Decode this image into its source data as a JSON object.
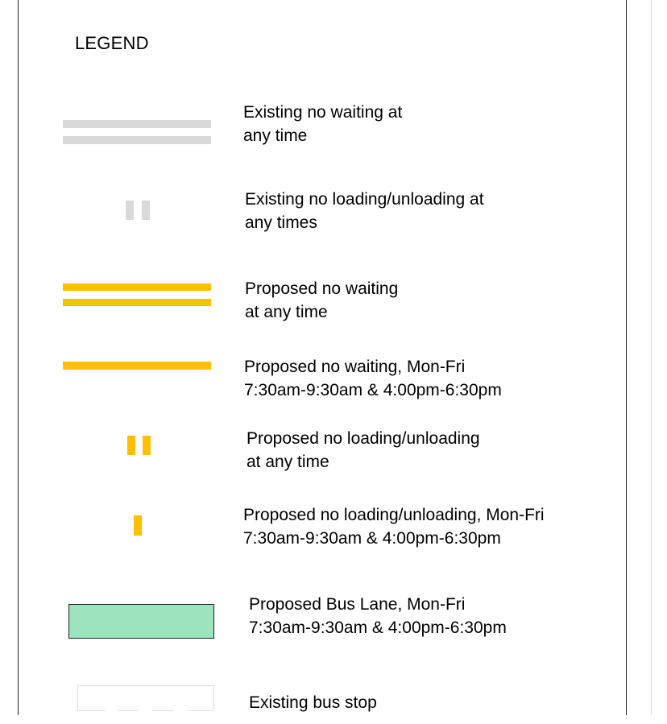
{
  "legend": {
    "title": "LEGEND",
    "colors": {
      "existing": "#d9d9d9",
      "proposed": "#ffc000",
      "bus_lane_fill": "#9de3bd",
      "bus_lane_border": "#222222",
      "bus_stop_outline": "#dddddd",
      "frame": "#222222"
    },
    "items": [
      {
        "symbol": "double-line-grey",
        "line1": "Existing no waiting at",
        "line2": "any time"
      },
      {
        "symbol": "double-tick-grey",
        "line1": "Existing no loading/unloading at",
        "line2": "any times"
      },
      {
        "symbol": "double-line-yellow",
        "line1": "Proposed no waiting",
        "line2": "at any time"
      },
      {
        "symbol": "single-line-yellow",
        "line1": "Proposed no waiting, Mon-Fri",
        "line2": "7:30am-9:30am & 4:00pm-6:30pm"
      },
      {
        "symbol": "double-tick-yellow",
        "line1": "Proposed no loading/unloading",
        "line2": "at any time"
      },
      {
        "symbol": "single-tick-yellow",
        "line1": "Proposed no loading/unloading, Mon-Fri",
        "line2": "7:30am-9:30am & 4:00pm-6:30pm"
      },
      {
        "symbol": "bus-lane-box",
        "line1": "Proposed Bus Lane, Mon-Fri",
        "line2": "7:30am-9:30am & 4:00pm-6:30pm"
      },
      {
        "symbol": "bus-stop-outline",
        "line1": "Existing bus stop",
        "line2": ""
      }
    ]
  }
}
